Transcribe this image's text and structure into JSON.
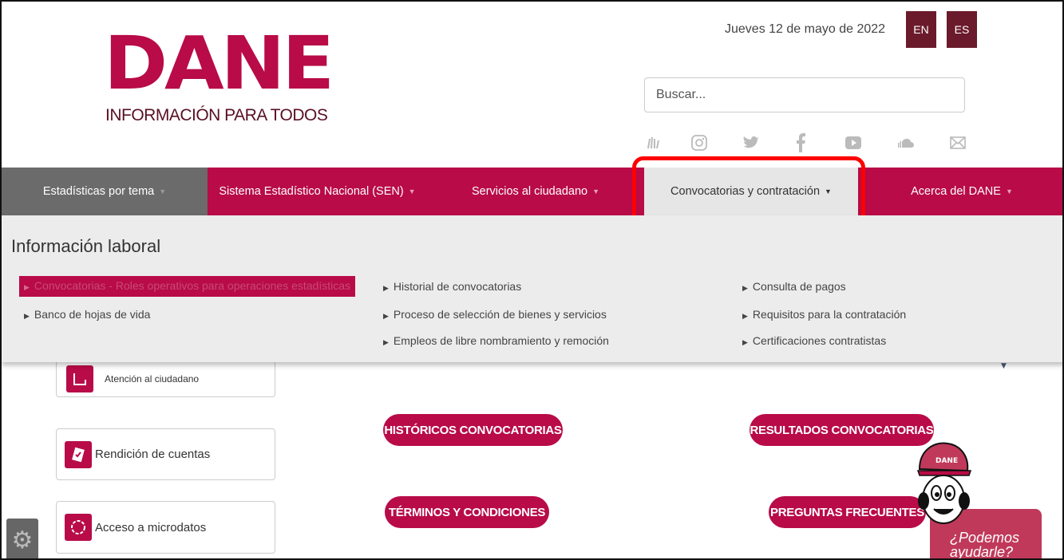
{
  "header": {
    "logo_text": "DANE",
    "logo_tagline": "INFORMACIÓN PARA TODOS",
    "date": "Jueves 12 de mayo de 2022",
    "lang_en": "EN",
    "lang_es": "ES",
    "search_placeholder": "Buscar..."
  },
  "social_icons": [
    "sign-language-icon",
    "instagram-icon",
    "twitter-icon",
    "facebook-icon",
    "youtube-icon",
    "soundcloud-icon",
    "mail-icon"
  ],
  "nav": {
    "items": [
      {
        "label": "Estadísticas por tema"
      },
      {
        "label": "Sistema Estadístico Nacional (SEN)"
      },
      {
        "label": "Servicios al ciudadano"
      },
      {
        "label": "Convocatorias y contratación"
      },
      {
        "label": "Acerca del DANE"
      }
    ]
  },
  "mega_menu": {
    "title": "Información laboral",
    "col1": [
      {
        "label": "Convocatorias - Roles operativos para operaciones estadísticas"
      },
      {
        "label": "Banco de hojas de vida"
      }
    ],
    "col2": [
      {
        "label": "Historial de convocatorias"
      },
      {
        "label": "Proceso de selección de bienes y servicios"
      },
      {
        "label": "Empleos de libre nombramiento y remoción"
      }
    ],
    "col3": [
      {
        "label": "Consulta de pagos"
      },
      {
        "label": "Requisitos para la contratación"
      },
      {
        "label": "Certificaciones contratistas"
      }
    ]
  },
  "cards": [
    {
      "label": "Atención al ciudadano"
    },
    {
      "label": "Rendición de cuentas"
    },
    {
      "label": "Acceso a microdatos"
    }
  ],
  "buttons": {
    "historicos": "HISTÓRICOS CONVOCATORIAS",
    "resultados": "RESULTADOS CONVOCATORIAS",
    "terminos": "TÉRMINOS Y CONDICIONES",
    "preguntas": "PREGUNTAS FRECUENTES"
  },
  "help": {
    "line1": "¿Podemos",
    "line2": "ayudarle?",
    "mascot_cap": "DANE"
  },
  "colors": {
    "brand": "#b80b47",
    "highlight": "#ff0000",
    "lang_bg": "#6a1a2b"
  }
}
